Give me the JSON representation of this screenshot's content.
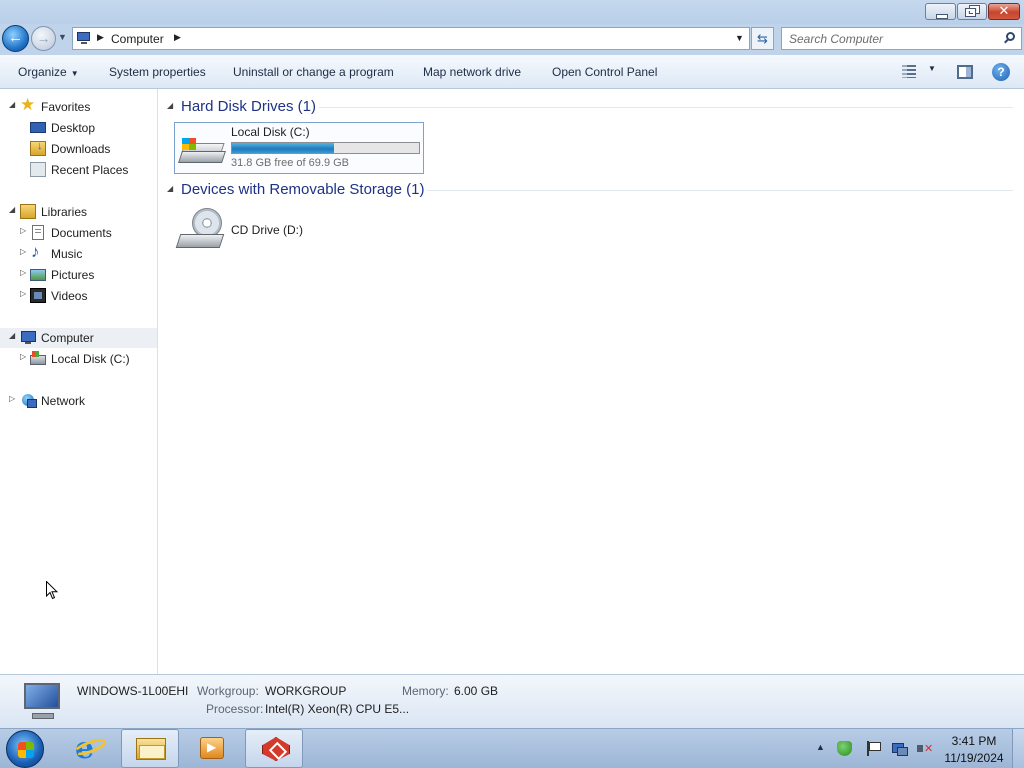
{
  "window": {
    "controls": {
      "minimize": "minimize",
      "maximize": "restore",
      "close": "close"
    }
  },
  "address": {
    "crumb": "Computer",
    "search_placeholder": "Search Computer"
  },
  "commands": {
    "organize": "Organize",
    "system_properties": "System properties",
    "uninstall": "Uninstall or change a program",
    "map_drive": "Map network drive",
    "control_panel": "Open Control Panel"
  },
  "nav": {
    "favorites": "Favorites",
    "desktop": "Desktop",
    "downloads": "Downloads",
    "recent": "Recent Places",
    "libraries": "Libraries",
    "documents": "Documents",
    "music": "Music",
    "pictures": "Pictures",
    "videos": "Videos",
    "computer": "Computer",
    "local_disk": "Local Disk (C:)",
    "network": "Network"
  },
  "groups": {
    "hdd_title": "Hard Disk Drives (1)",
    "removable_title": "Devices with Removable Storage (1)"
  },
  "drives": {
    "c": {
      "name": "Local Disk (C:)",
      "free_text": "31.8 GB free of 69.9 GB",
      "used_fraction": 0.545
    },
    "d": {
      "name": "CD Drive (D:)"
    }
  },
  "details": {
    "computer_name": "WINDOWS-1L00EHI",
    "workgroup_label": "Workgroup:",
    "workgroup_value": "WORKGROUP",
    "memory_label": "Memory:",
    "memory_value": "6.00 GB",
    "processor_label": "Processor:",
    "processor_value": "Intel(R) Xeon(R) CPU E5..."
  },
  "taskbar": {
    "time": "3:41 PM",
    "date": "11/19/2024",
    "apps": [
      "internet-explorer",
      "windows-explorer",
      "media-player",
      "red-app"
    ]
  },
  "colors": {
    "accent": "#1e3287",
    "progress": "#1f7ab9",
    "titlebar": "#c5d8ee"
  }
}
